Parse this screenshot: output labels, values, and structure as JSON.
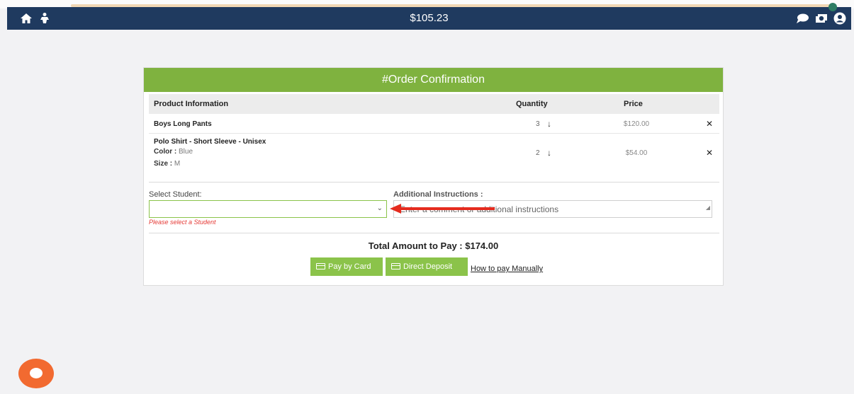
{
  "header": {
    "balance": "$105.23",
    "icons": [
      "home-icon",
      "person-icon",
      "chat-icon",
      "money-icon",
      "user-icon"
    ]
  },
  "order": {
    "title": "#Order Confirmation",
    "columns": {
      "product": "Product Information",
      "quantity": "Quantity",
      "price": "Price"
    },
    "items": [
      {
        "name": "Boys Long Pants",
        "quantity": "3",
        "price": "$120.00"
      },
      {
        "name": "Polo Shirt - Short Sleeve - Unisex",
        "color_label": "Color :",
        "color": "Blue",
        "size_label": "Size :",
        "size": "M",
        "quantity": "2",
        "price": "$54.00"
      }
    ],
    "down_glyph": "↓",
    "remove_glyph": "✕"
  },
  "form": {
    "student_label": "Select Student:",
    "student_error": "Please select a Student",
    "instructions_label": "Additional Instructions :",
    "instructions_placeholder": "Enter a comment or additional instructions"
  },
  "payment": {
    "total": "Total Amount to Pay : $174.00",
    "pay_card": "Pay by Card",
    "direct_deposit": "Direct Deposit",
    "manual_link": "How to pay Manually"
  },
  "colors": {
    "topbar": "#1f3a5f",
    "accent_green": "#7fb23f",
    "button_green": "#8bc34a",
    "error_red": "#e53935",
    "chat_orange": "#f26a30"
  }
}
